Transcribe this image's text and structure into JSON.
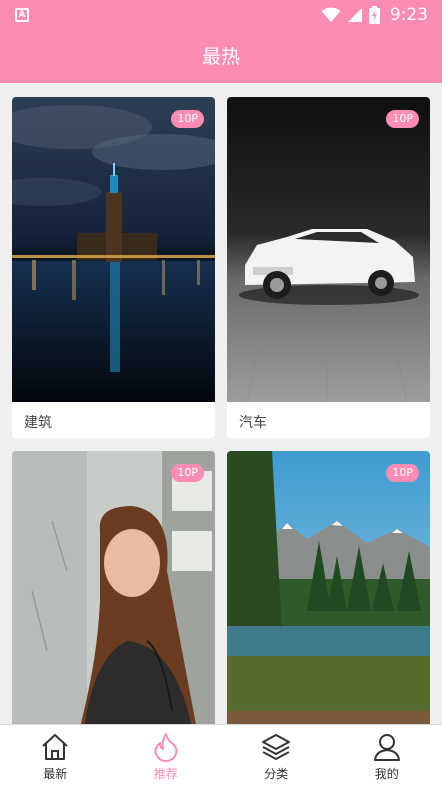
{
  "status_bar": {
    "app_icon_letter": "A",
    "time": "9:23"
  },
  "header": {
    "title": "最热"
  },
  "cards": [
    {
      "badge": "10P",
      "label": "建筑",
      "image": "city-night-tower"
    },
    {
      "badge": "10P",
      "label": "汽车",
      "image": "white-suv"
    },
    {
      "badge": "10P",
      "label": "",
      "image": "girl-portrait"
    },
    {
      "badge": "10P",
      "label": "",
      "image": "mountain-lake-forest"
    }
  ],
  "tabs": [
    {
      "label": "最新",
      "icon": "home-icon",
      "active": false
    },
    {
      "label": "推荐",
      "icon": "flame-icon",
      "active": true
    },
    {
      "label": "分类",
      "icon": "layers-icon",
      "active": false
    },
    {
      "label": "我的",
      "icon": "user-icon",
      "active": false
    }
  ],
  "colors": {
    "accent": "#fd8cb4",
    "background": "#efefef",
    "text": "#333333"
  }
}
